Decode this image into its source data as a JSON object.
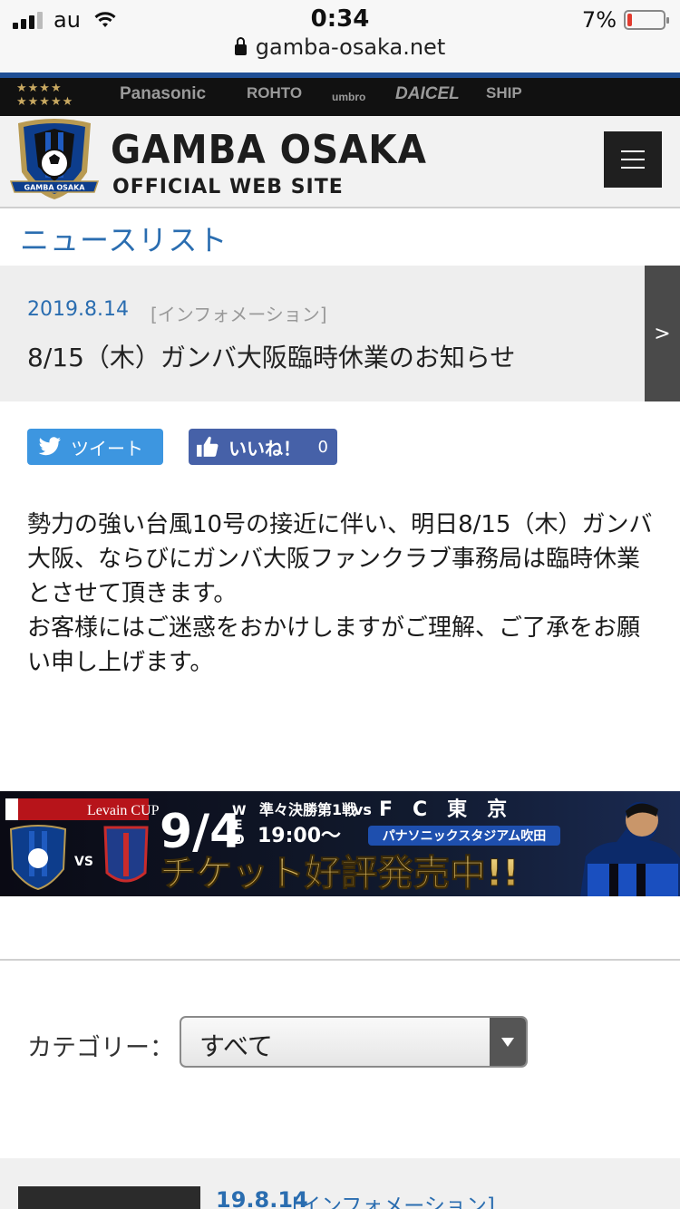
{
  "status_bar": {
    "carrier": "au",
    "time": "0:34",
    "battery_percent": "7%",
    "battery_level": 0.07,
    "url": "gamba-osaka.net"
  },
  "sponsors": {
    "stars": "★★★★\n★★★★★",
    "items": [
      "Panasonic",
      "ROHTO",
      "umbro",
      "DAICEL",
      "SHIP"
    ]
  },
  "header": {
    "title": "GAMBA OSAKA",
    "subtitle": "OFFICIAL WEB SITE",
    "logo_text": "GAMBA OSAKA"
  },
  "section_heading": "ニュースリスト",
  "article": {
    "date": "2019.8.14",
    "category": "[インフォメーション]",
    "title": "8/15（木）ガンバ大阪臨時休業のお知らせ",
    "paragraph1": "勢力の強い台風10号の接近に伴い、明日8/15（木）ガンバ大阪、ならびにガンバ大阪ファンクラブ事務局は臨時休業とさせて頂きます。",
    "paragraph2": "お客様にはご迷惑をおかけしますがご理解、ご了承をお願い申し上げます。"
  },
  "share": {
    "tweet_label": "ツイート",
    "like_label": "いいね！",
    "like_count": "0"
  },
  "banner": {
    "cup_label": "Levain CUP",
    "date": "9/4",
    "weekday": "WED",
    "round": "準々決勝第1戦",
    "versus": "vs",
    "opponent": "F　C　東　京",
    "time": "19:00〜",
    "venue": "パナソニックスタジアム吹田",
    "headline": "チケット好評発売中!!",
    "vs_small": "VS"
  },
  "category_filter": {
    "label": "カテゴリー：",
    "selected": "すべて"
  },
  "list": {
    "first_item_date": "19.8.14",
    "first_item_category": "[インフォメーション]"
  }
}
